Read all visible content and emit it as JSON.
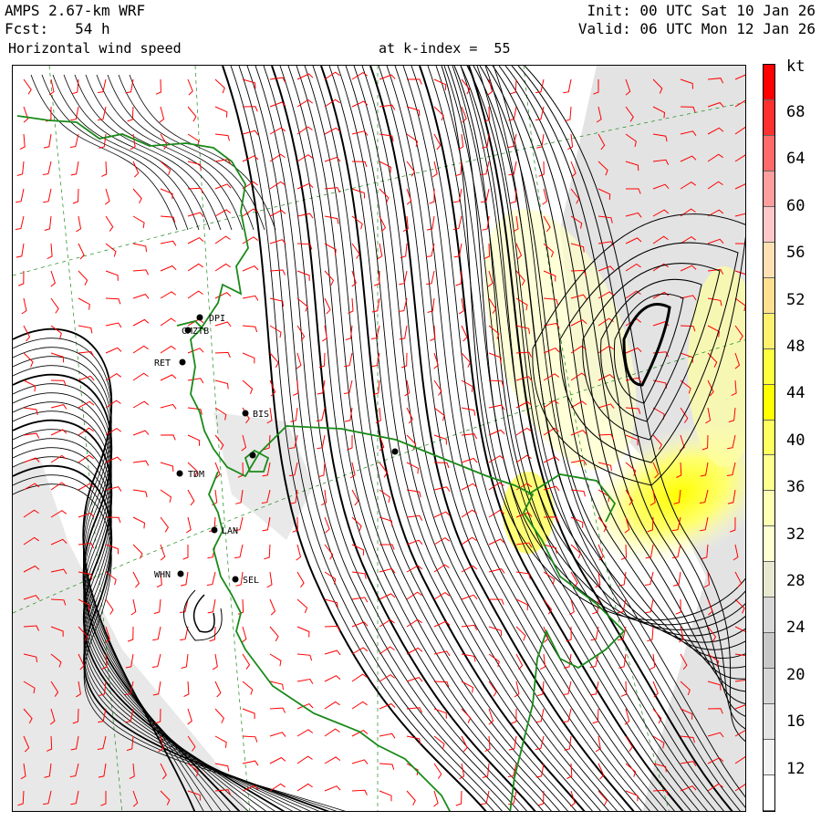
{
  "header": {
    "model": "AMPS 2.67-km WRF",
    "forecast": "Fcst:   54 h",
    "field": "Horizontal wind speed",
    "init": "Init: 00 UTC Sat 10 Jan 26",
    "valid": "Valid: 06 UTC Mon 12 Jan 26",
    "level": "at k-index =  55"
  },
  "colorbar": {
    "unit": "kt",
    "ticks": [
      "68",
      "64",
      "60",
      "56",
      "52",
      "48",
      "44",
      "40",
      "36",
      "32",
      "28",
      "24",
      "20",
      "16",
      "12"
    ],
    "colors": [
      "#ff0000",
      "#ff3030",
      "#ff6a6a",
      "#ff9e9e",
      "#ffc8c8",
      "#ffe0b4",
      "#ffe090",
      "#fff070",
      "#ffff40",
      "#ffff00",
      "#ffff60",
      "#ffff90",
      "#ffffb4",
      "#ffffd2",
      "#e8e8d0",
      "#d8d8d8",
      "#c8c8c8",
      "#d6d6d6",
      "#e4e4e4",
      "#f2f2f2",
      "#ffffff"
    ]
  },
  "stations": [
    {
      "id": "stn-dpi",
      "label": "DPI"
    },
    {
      "id": "stn-cmz",
      "label": "CMZTB"
    },
    {
      "id": "stn-ret",
      "label": "RET"
    },
    {
      "id": "stn-bis",
      "label": "BIS"
    },
    {
      "id": "stn-tdm",
      "label": "TDM"
    },
    {
      "id": "stn-lan",
      "label": "LAN"
    },
    {
      "id": "stn-whn",
      "label": "WHN"
    },
    {
      "id": "stn-sel",
      "label": "SEL"
    }
  ],
  "colors": {
    "coastline": "#1a8a1a",
    "barbs": "#ff0000",
    "streamlines": "#000000",
    "gridlines": "#1a8a1a"
  }
}
